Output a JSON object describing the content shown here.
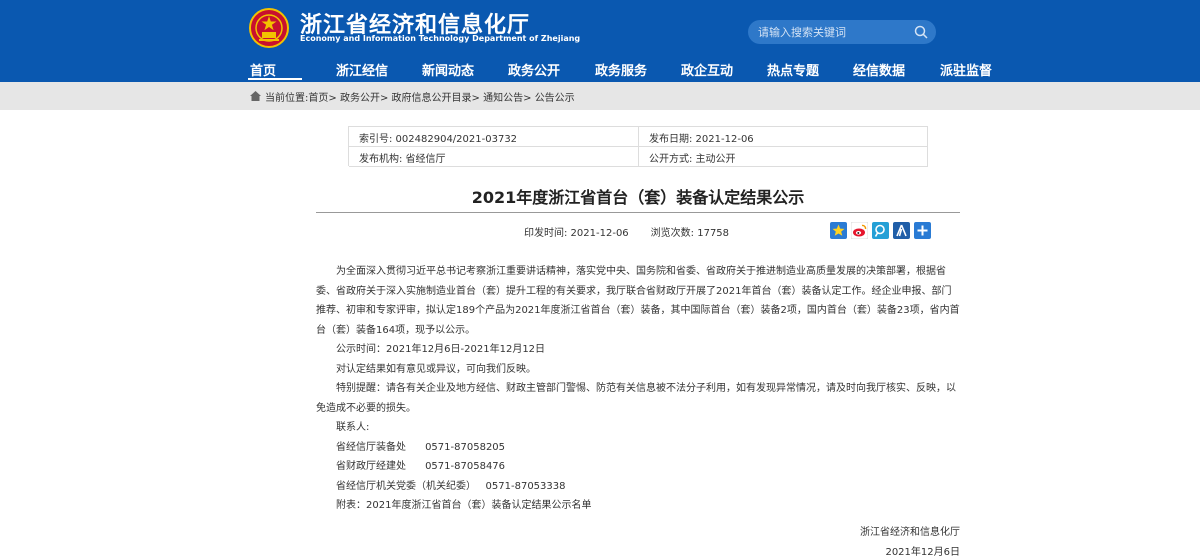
{
  "colors": {
    "header_bg": "#0a58b0",
    "breadcrumb_bg": "#e6e6e6",
    "search_bg": "#2e78c9"
  },
  "header": {
    "title": "浙江省经济和信息化厅",
    "subtitle": "Economy and Information Technology Department of Zhejiang",
    "logo_icon": "national-emblem-icon",
    "search_placeholder": "请输入搜索关键词"
  },
  "nav": {
    "items": [
      {
        "label": "首页",
        "active": true
      },
      {
        "label": "浙江经信"
      },
      {
        "label": "新闻动态"
      },
      {
        "label": "政务公开"
      },
      {
        "label": "政务服务"
      },
      {
        "label": "政企互动"
      },
      {
        "label": "热点专题"
      },
      {
        "label": "经信数据"
      },
      {
        "label": "派驻监督"
      }
    ]
  },
  "breadcrumb": {
    "prefix": "当前位置:",
    "items": [
      "首页",
      "政务公开",
      "政府信息公开目录",
      "通知公告",
      "公告公示"
    ],
    "separator": ">"
  },
  "meta": {
    "index_no": "索引号: 002482904/2021-03732",
    "publish_date": "发布日期: 2021-12-06",
    "publisher": "发布机构: 省经信厅",
    "open_mode": "公开方式: 主动公开"
  },
  "article": {
    "title": "2021年度浙江省首台（套）装备认定结果公示",
    "print_time": "印发时间:  2021-12-06",
    "views": "浏览次数:  17758",
    "share_icons": [
      "favorite-icon",
      "weibo-icon",
      "tencent-weibo-icon",
      "renren-icon",
      "more-share-icon"
    ],
    "paragraphs": [
      "为全面深入贯彻习近平总书记考察浙江重要讲话精神，落实党中央、国务院和省委、省政府关于推进制造业高质量发展的决策部署，根据省委、省政府关于深入实施制造业首台（套）提升工程的有关要求，我厅联合省财政厅开展了2021年首台（套）装备认定工作。经企业申报、部门推荐、初审和专家评审，拟认定189个产品为2021年度浙江省首台（套）装备，其中国际首台（套）装备2项，国内首台（套）装备23项，省内首台（套）装备164项，现予以公示。",
      "公示时间：2021年12月6日-2021年12月12日",
      "对认定结果如有意见或异议，可向我们反映。",
      "特别提醒：请各有关企业及地方经信、财政主管部门警惕、防范有关信息被不法分子利用，如有发现异常情况，请及时向我厅核实、反映，以免造成不必要的损失。",
      "联系人:",
      "省经信厅装备处      0571-87058205",
      "省财政厅经建处      0571-87058476",
      "省经信厅机关党委（机关纪委）   0571-87053338",
      "附表：2021年度浙江省首台（套）装备认定结果公示名单"
    ],
    "signature": "浙江省经济和信息化厅",
    "date": "2021年12月6日"
  }
}
